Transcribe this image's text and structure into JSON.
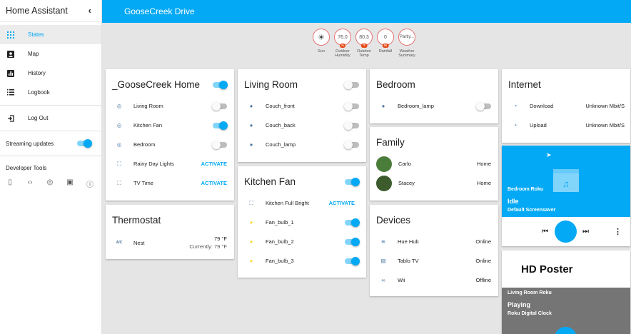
{
  "sidebar": {
    "title": "Home Assistant",
    "collapse_glyph": "‹",
    "nav": [
      {
        "label": "States",
        "icon": "apps-grid-icon"
      },
      {
        "label": "Map",
        "icon": "account-box-icon"
      },
      {
        "label": "History",
        "icon": "bar-chart-icon"
      },
      {
        "label": "Logbook",
        "icon": "list-icon"
      },
      {
        "label": "Log Out",
        "icon": "exit-icon"
      }
    ],
    "streaming_label": "Streaming updates",
    "streaming_on": true,
    "dev_tools_label": "Developer Tools",
    "dev_icons": [
      "remote-icon",
      "code-icon",
      "fingerprint-icon",
      "file-upload-icon",
      "info-icon"
    ]
  },
  "topbar": {
    "title": "GooseCreek Drive"
  },
  "badges": [
    {
      "value": "☀",
      "unit": "",
      "label": "Sun"
    },
    {
      "value": "76.0",
      "unit": "%",
      "label": "Outdoor Humidity"
    },
    {
      "value": "80.3",
      "unit": "°F",
      "label": "Outdoor Temp"
    },
    {
      "value": "0",
      "unit": "IN",
      "label": "Rainfall"
    },
    {
      "value": "Partly...",
      "unit": "",
      "label": "Weather Summary"
    }
  ],
  "cards": {
    "home": {
      "title": "_GooseCreek Home",
      "rows": [
        {
          "label": "Living Room",
          "type": "toggle",
          "on": false
        },
        {
          "label": "Kitchen Fan",
          "type": "toggle",
          "on": true
        },
        {
          "label": "Bedroom",
          "type": "toggle",
          "on": false
        },
        {
          "label": "Rainy Day Lights",
          "type": "activate",
          "action": "ACTIVATE"
        },
        {
          "label": "TV Time",
          "type": "activate",
          "action": "ACTIVATE"
        }
      ]
    },
    "thermostat": {
      "title": "Thermostat",
      "name": "Nest",
      "target": "79 °F",
      "current": "Currently: 79 °F",
      "icon_text": "A/C"
    },
    "living": {
      "title": "Living Room",
      "rows": [
        {
          "label": "Couch_front",
          "on": false
        },
        {
          "label": "Couch_back",
          "on": false
        },
        {
          "label": "Couch_lamp",
          "on": false
        }
      ]
    },
    "kitchen": {
      "title": "Kitchen Fan",
      "scene": {
        "label": "Kitchen Full Bright",
        "action": "ACTIVATE"
      },
      "rows": [
        {
          "label": "Fan_bulb_1",
          "on": true
        },
        {
          "label": "Fan_bulb_2",
          "on": true
        },
        {
          "label": "Fan_bulb_3",
          "on": true
        }
      ]
    },
    "bedroom": {
      "title": "Bedroom",
      "rows": [
        {
          "label": "Bedroom_lamp",
          "on": false
        }
      ]
    },
    "family": {
      "title": "Family",
      "rows": [
        {
          "label": "Carlo",
          "state": "Home"
        },
        {
          "label": "Stacey",
          "state": "Home"
        }
      ]
    },
    "devices": {
      "title": "Devices",
      "rows": [
        {
          "label": "Hue Hub",
          "state": "Online",
          "icon": "router-icon"
        },
        {
          "label": "Tablo TV",
          "state": "Online",
          "icon": "tv-guide-icon"
        },
        {
          "label": "Wii",
          "state": "Offline",
          "icon": "gamepad-icon"
        }
      ]
    },
    "internet": {
      "title": "Internet",
      "rows": [
        {
          "label": "Download",
          "state": "Unknown Mbit/S"
        },
        {
          "label": "Upload",
          "state": "Unknown Mbit/S"
        }
      ]
    }
  },
  "media": {
    "roku1": {
      "name": "Bedroom Roku",
      "state": "Idle",
      "sub": "Default Screensaver"
    },
    "roku2": {
      "poster": "HD Poster",
      "name": "Living Room Roku",
      "state": "Playing",
      "sub": "Roku Digital Clock"
    }
  },
  "colors": {
    "accent": "#03a9f4",
    "icon": "#44739e",
    "bulb_on": "#fdd835",
    "badge_border": "#e57373"
  }
}
